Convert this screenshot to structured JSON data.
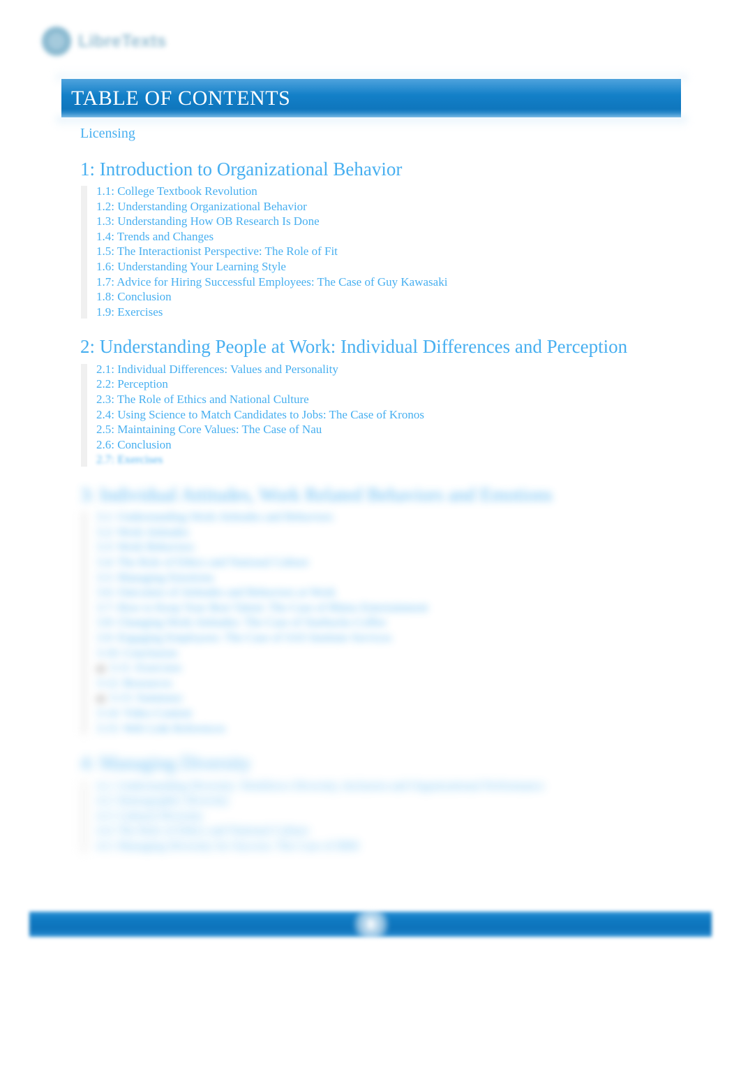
{
  "brand": {
    "logo_icon": "libretexts-circle-logo",
    "wordmark": "LibreTexts"
  },
  "header": {
    "title": "TABLE OF CONTENTS"
  },
  "front_matter": {
    "licensing_label": "Licensing"
  },
  "chapters": [
    {
      "title": "1: Introduction to Organizational Behavior",
      "sections": [
        "1.1: College Textbook Revolution",
        "1.2: Understanding Organizational Behavior",
        "1.3: Understanding How OB Research Is Done",
        "1.4: Trends and Changes",
        "1.5: The Interactionist Perspective: The Role of Fit",
        "1.6: Understanding Your Learning Style",
        "1.7: Advice for Hiring Successful Employees: The Case of Guy Kawasaki",
        "1.8: Conclusion",
        "1.9: Exercises"
      ],
      "blur": "none"
    },
    {
      "title": "2: Understanding People at Work: Individual Differences and Perception",
      "sections": [
        "2.1: Individual Differences: Values and Personality",
        "2.2: Perception",
        "2.3: The Role of Ethics and National Culture",
        "2.4: Using Science to Match Candidates to Jobs: The Case of Kronos",
        "2.5: Maintaining Core Values: The Case of Nau",
        "2.6: Conclusion",
        "2.7: Exercises"
      ],
      "blur": "tail"
    },
    {
      "title": "3: Individual Attitudes, Work Related Behaviors and Emotions",
      "sections": [
        "3.1: Understanding Work Attitudes and Behaviors",
        "3.2: Work Attitudes",
        "3.3: Work Behaviors",
        "3.4: The Role of Ethics and National Culture",
        "3.5: Managing Emotions",
        "3.6: Outcomes of Attitudes and Behaviors at Work",
        "3.7: How to Keep Your Best Talent: The Case of Rhino Entertainment",
        "3.8: Changing Work Attitudes: The Case of Starbucks Coffee",
        "3.9: Engaging Employees: The Case of SAS Institute Services",
        "3.10: Conclusion",
        "3.11: Exercises",
        "3.12: Resources",
        "3.13: Summary",
        "3.14: Video Content",
        "3.15: Web Link References"
      ],
      "blur": "heavy"
    },
    {
      "title": "4: Managing Diversity",
      "sections": [
        "4.1: Understanding Diversity: Workforce Diversity, Inclusion and Organizational Performance",
        "4.2: Demographic Diversity",
        "4.3: Cultural Diversity",
        "4.4: The Role of Ethics and National Culture",
        "4.5: Managing Diversity for Success: The Case of IBM"
      ],
      "blur": "heavy"
    }
  ],
  "footer": {
    "page_number": "1"
  },
  "colors": {
    "link_blue": "#47aff0",
    "header_blue": "#1380c8",
    "footer_blue": "#0f7ac2",
    "header_text": "#ffffff",
    "page_background": "#ffffff",
    "guide_rail": "#f0f0f0"
  }
}
